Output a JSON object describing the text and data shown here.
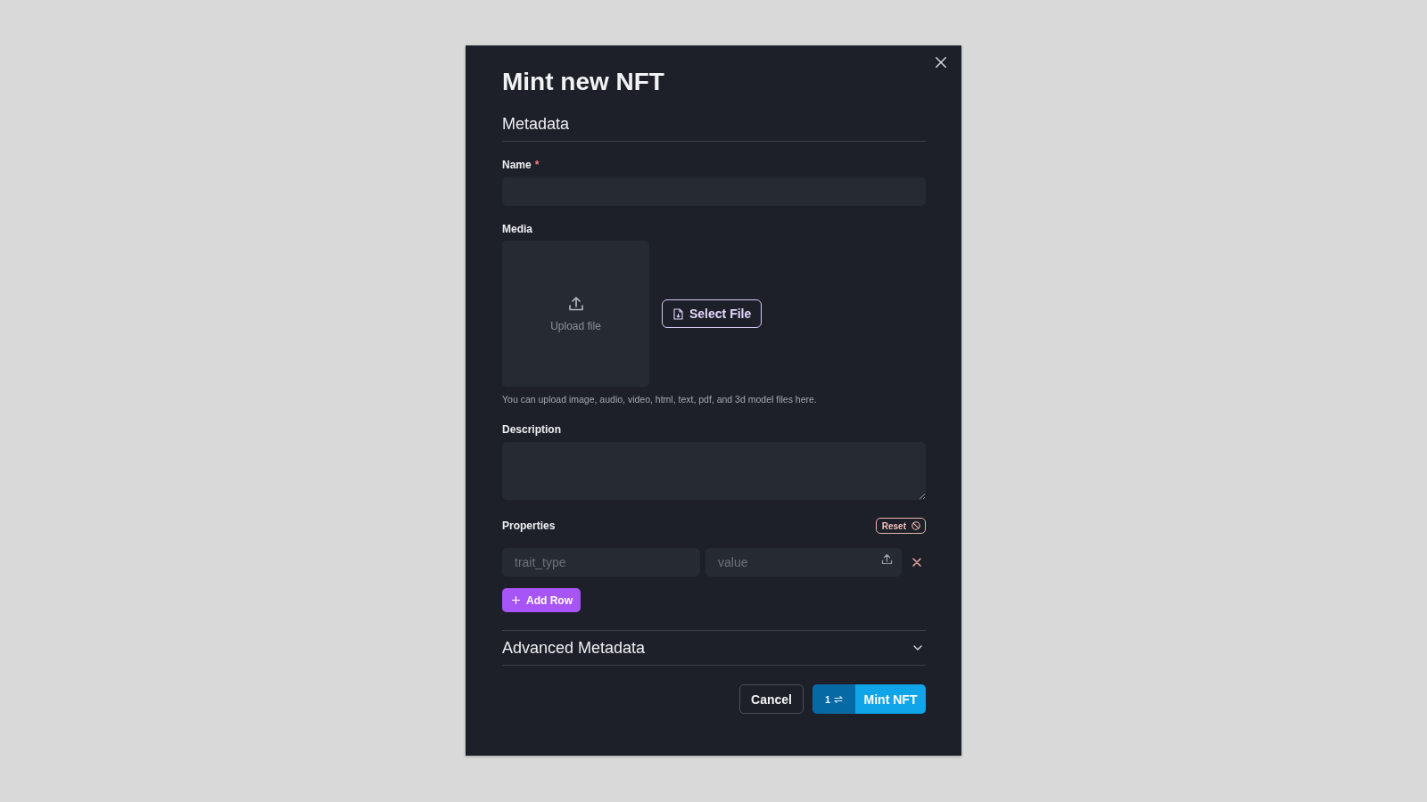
{
  "dialog": {
    "title": "Mint new NFT",
    "section_title": "Metadata",
    "fields": [
      {
        "kind": "text",
        "label": "Name",
        "required_mark": "*"
      },
      {
        "kind": "media",
        "label": "Media",
        "upload_text": "Upload file",
        "button": "Select File",
        "hint": "You can upload image, audio, video, html, text, pdf, and 3d model files here."
      },
      {
        "kind": "textarea",
        "label": "Description"
      }
    ],
    "properties": {
      "label": "Properties",
      "reset_button": "Reset",
      "rows": [
        {
          "trait_type": {
            "placeholder": "trait_type"
          },
          "value": {
            "placeholder": "value"
          }
        }
      ],
      "add_button": "Add Row"
    },
    "advanced": {
      "title": "Advanced Metadata",
      "expanded": false
    },
    "footer": {
      "cancel_button": "Cancel",
      "quantity": "1",
      "mint_button": "Mint NFT"
    }
  }
}
